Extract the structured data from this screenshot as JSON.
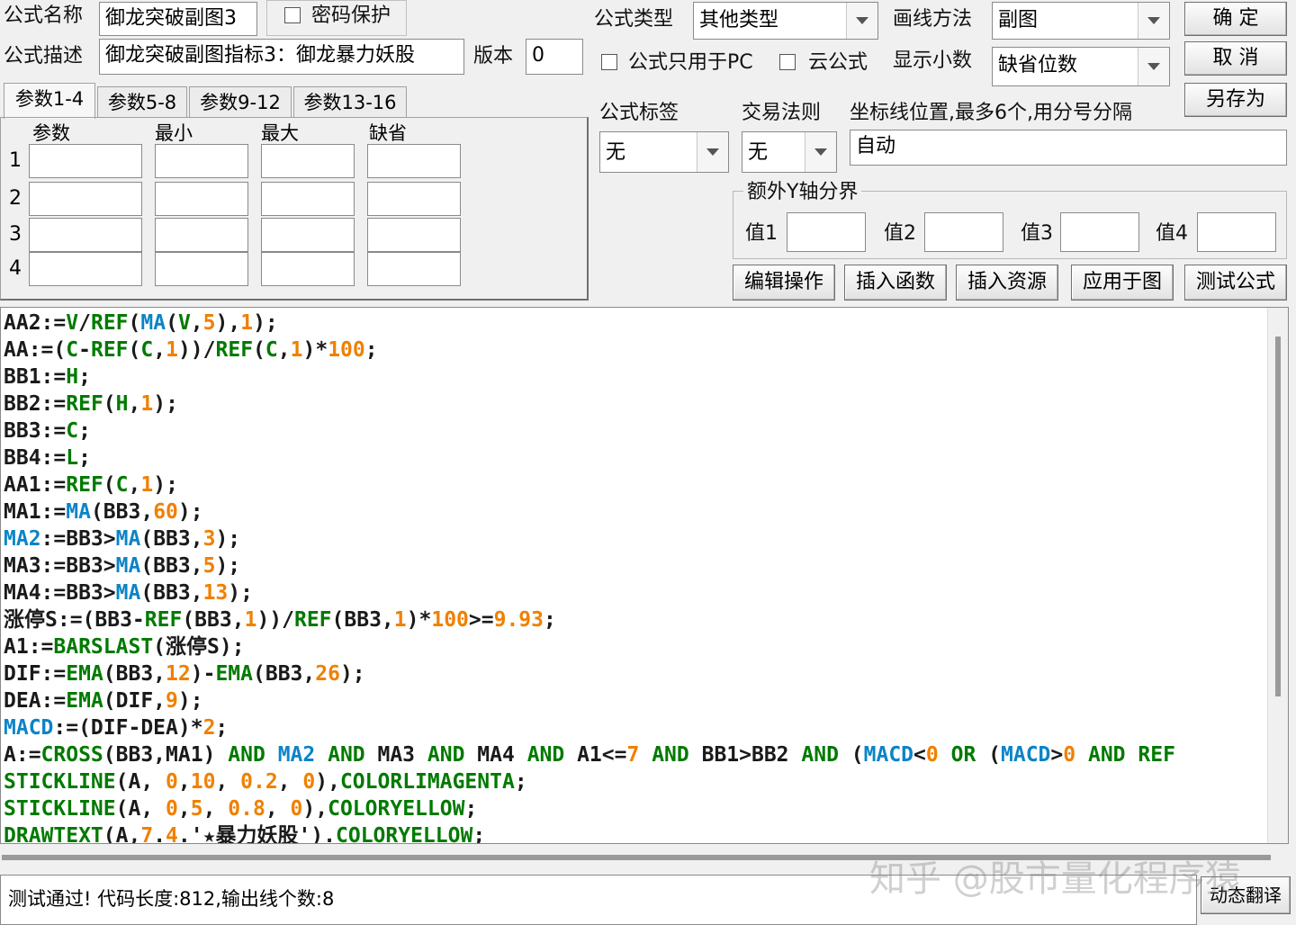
{
  "form": {
    "name_label": "公式名称",
    "name_value": "御龙突破副图3",
    "password_label": "密码保护",
    "desc_label": "公式描述",
    "desc_value": "御龙突破副图指标3：御龙暴力妖股",
    "version_label": "版本",
    "version_value": "0",
    "type_label": "公式类型",
    "type_value": "其他类型",
    "draw_label": "画线方法",
    "draw_value": "副图",
    "pc_only_label": "公式只用于PC",
    "cloud_label": "云公式",
    "decimal_label": "显示小数",
    "decimal_value": "缺省位数",
    "tag_label": "公式标签",
    "tag_value": "无",
    "rule_label": "交易法则",
    "rule_value": "无",
    "axis_label": "坐标线位置,最多6个,用分号分隔",
    "axis_value": "自动",
    "yaxis_group": "额外Y轴分界",
    "yaxis_fields": [
      "值1",
      "值2",
      "值3",
      "值4"
    ]
  },
  "buttons": {
    "ok": "确  定",
    "cancel": "取  消",
    "save_as": "另存为",
    "edit": "编辑操作",
    "insert_func": "插入函数",
    "insert_res": "插入资源",
    "apply": "应用于图",
    "test": "测试公式",
    "dynamic": "动态翻译"
  },
  "params": {
    "tabs": [
      "参数1-4",
      "参数5-8",
      "参数9-12",
      "参数13-16"
    ],
    "headers": [
      "参数",
      "最小",
      "最大",
      "缺省"
    ],
    "rows": [
      "1",
      "2",
      "3",
      "4"
    ]
  },
  "code_lines": [
    [
      [
        "w",
        "AA2:="
      ],
      [
        "k",
        "V"
      ],
      [
        "w",
        "/"
      ],
      [
        "k",
        "REF"
      ],
      [
        "w",
        "("
      ],
      [
        "f",
        "MA"
      ],
      [
        "w",
        "("
      ],
      [
        "k",
        "V"
      ],
      [
        "w",
        ","
      ],
      [
        "n",
        "5"
      ],
      [
        "w",
        "),"
      ],
      [
        "n",
        "1"
      ],
      [
        "w",
        ");"
      ]
    ],
    [
      [
        "w",
        "AA:=("
      ],
      [
        "k",
        "C"
      ],
      [
        "w",
        "-"
      ],
      [
        "k",
        "REF"
      ],
      [
        "w",
        "("
      ],
      [
        "k",
        "C"
      ],
      [
        "w",
        ","
      ],
      [
        "n",
        "1"
      ],
      [
        "w",
        "))/"
      ],
      [
        "k",
        "REF"
      ],
      [
        "w",
        "("
      ],
      [
        "k",
        "C"
      ],
      [
        "w",
        ","
      ],
      [
        "n",
        "1"
      ],
      [
        "w",
        ")*"
      ],
      [
        "n",
        "100"
      ],
      [
        "w",
        ";"
      ]
    ],
    [
      [
        "w",
        "BB1:="
      ],
      [
        "k",
        "H"
      ],
      [
        "w",
        ";"
      ]
    ],
    [
      [
        "w",
        "BB2:="
      ],
      [
        "k",
        "REF"
      ],
      [
        "w",
        "("
      ],
      [
        "k",
        "H"
      ],
      [
        "w",
        ","
      ],
      [
        "n",
        "1"
      ],
      [
        "w",
        ");"
      ]
    ],
    [
      [
        "w",
        "BB3:="
      ],
      [
        "k",
        "C"
      ],
      [
        "w",
        ";"
      ]
    ],
    [
      [
        "w",
        "BB4:="
      ],
      [
        "k",
        "L"
      ],
      [
        "w",
        ";"
      ]
    ],
    [
      [
        "w",
        "AA1:="
      ],
      [
        "k",
        "REF"
      ],
      [
        "w",
        "("
      ],
      [
        "k",
        "C"
      ],
      [
        "w",
        ","
      ],
      [
        "n",
        "1"
      ],
      [
        "w",
        ");"
      ]
    ],
    [
      [
        "w",
        "MA1:="
      ],
      [
        "f",
        "MA"
      ],
      [
        "w",
        "(BB3,"
      ],
      [
        "n",
        "60"
      ],
      [
        "w",
        ");"
      ]
    ],
    [
      [
        "f",
        "MA2"
      ],
      [
        "w",
        ":=BB3>"
      ],
      [
        "f",
        "MA"
      ],
      [
        "w",
        "(BB3,"
      ],
      [
        "n",
        "3"
      ],
      [
        "w",
        ");"
      ]
    ],
    [
      [
        "w",
        "MA3:=BB3>"
      ],
      [
        "f",
        "MA"
      ],
      [
        "w",
        "(BB3,"
      ],
      [
        "n",
        "5"
      ],
      [
        "w",
        ");"
      ]
    ],
    [
      [
        "w",
        "MA4:=BB3>"
      ],
      [
        "f",
        "MA"
      ],
      [
        "w",
        "(BB3,"
      ],
      [
        "n",
        "13"
      ],
      [
        "w",
        ");"
      ]
    ],
    [
      [
        "w",
        "涨停S:=(BB3-"
      ],
      [
        "k",
        "REF"
      ],
      [
        "w",
        "(BB3,"
      ],
      [
        "n",
        "1"
      ],
      [
        "w",
        "))/"
      ],
      [
        "k",
        "REF"
      ],
      [
        "w",
        "(BB3,"
      ],
      [
        "n",
        "1"
      ],
      [
        "w",
        ")*"
      ],
      [
        "n",
        "100"
      ],
      [
        "w",
        ">="
      ],
      [
        "n",
        "9.93"
      ],
      [
        "w",
        ";"
      ]
    ],
    [
      [
        "w",
        "A1:="
      ],
      [
        "k",
        "BARSLAST"
      ],
      [
        "w",
        "(涨停S);"
      ]
    ],
    [
      [
        "w",
        "DIF:="
      ],
      [
        "k",
        "EMA"
      ],
      [
        "w",
        "(BB3,"
      ],
      [
        "n",
        "12"
      ],
      [
        "w",
        ")-"
      ],
      [
        "k",
        "EMA"
      ],
      [
        "w",
        "(BB3,"
      ],
      [
        "n",
        "26"
      ],
      [
        "w",
        ");"
      ]
    ],
    [
      [
        "w",
        "DEA:="
      ],
      [
        "k",
        "EMA"
      ],
      [
        "w",
        "(DIF,"
      ],
      [
        "n",
        "9"
      ],
      [
        "w",
        ");"
      ]
    ],
    [
      [
        "f",
        "MACD"
      ],
      [
        "w",
        ":=(DIF-DEA)*"
      ],
      [
        "n",
        "2"
      ],
      [
        "w",
        ";"
      ]
    ],
    [
      [
        "w",
        "A:="
      ],
      [
        "k",
        "CROSS"
      ],
      [
        "w",
        "(BB3,MA1) "
      ],
      [
        "k",
        "AND"
      ],
      [
        "w",
        " "
      ],
      [
        "f",
        "MA2"
      ],
      [
        "w",
        " "
      ],
      [
        "k",
        "AND"
      ],
      [
        "w",
        " MA3 "
      ],
      [
        "k",
        "AND"
      ],
      [
        "w",
        " MA4 "
      ],
      [
        "k",
        "AND"
      ],
      [
        "w",
        " A1<="
      ],
      [
        "n",
        "7"
      ],
      [
        "w",
        " "
      ],
      [
        "k",
        "AND"
      ],
      [
        "w",
        " BB1>BB2 "
      ],
      [
        "k",
        "AND"
      ],
      [
        "w",
        " ("
      ],
      [
        "f",
        "MACD"
      ],
      [
        "w",
        "<"
      ],
      [
        "n",
        "0"
      ],
      [
        "w",
        " "
      ],
      [
        "k",
        "OR"
      ],
      [
        "w",
        " ("
      ],
      [
        "f",
        "MACD"
      ],
      [
        "w",
        ">"
      ],
      [
        "n",
        "0"
      ],
      [
        "w",
        " "
      ],
      [
        "k",
        "AND"
      ],
      [
        "w",
        " "
      ],
      [
        "k",
        "REF"
      ]
    ],
    [
      [
        "k",
        "STICKLINE"
      ],
      [
        "w",
        "(A, "
      ],
      [
        "n",
        "0"
      ],
      [
        "w",
        ","
      ],
      [
        "n",
        "10"
      ],
      [
        "w",
        ", "
      ],
      [
        "n",
        "0.2"
      ],
      [
        "w",
        ", "
      ],
      [
        "n",
        "0"
      ],
      [
        "w",
        "),"
      ],
      [
        "k",
        "COLORLIMAGENTA"
      ],
      [
        "w",
        ";"
      ]
    ],
    [
      [
        "k",
        "STICKLINE"
      ],
      [
        "w",
        "(A, "
      ],
      [
        "n",
        "0"
      ],
      [
        "w",
        ","
      ],
      [
        "n",
        "5"
      ],
      [
        "w",
        ", "
      ],
      [
        "n",
        "0.8"
      ],
      [
        "w",
        ", "
      ],
      [
        "n",
        "0"
      ],
      [
        "w",
        "),"
      ],
      [
        "k",
        "COLORYELLOW"
      ],
      [
        "w",
        ";"
      ]
    ],
    [
      [
        "k",
        "DRAWTEXT"
      ],
      [
        "w",
        "(A,"
      ],
      [
        "n",
        "7"
      ],
      [
        "w",
        "."
      ],
      [
        "n",
        "4"
      ],
      [
        "w",
        ".'★暴力妖股')."
      ],
      [
        "k",
        "COLORYELLOW"
      ],
      [
        "w",
        ";"
      ]
    ]
  ],
  "status_text": "测试通过! 代码长度:812,输出线个数:8",
  "watermark": "知乎 @股市量化程序猿",
  "colors": {
    "keyword": "#007a00",
    "function": "#0a84c8",
    "number": "#f08000"
  }
}
